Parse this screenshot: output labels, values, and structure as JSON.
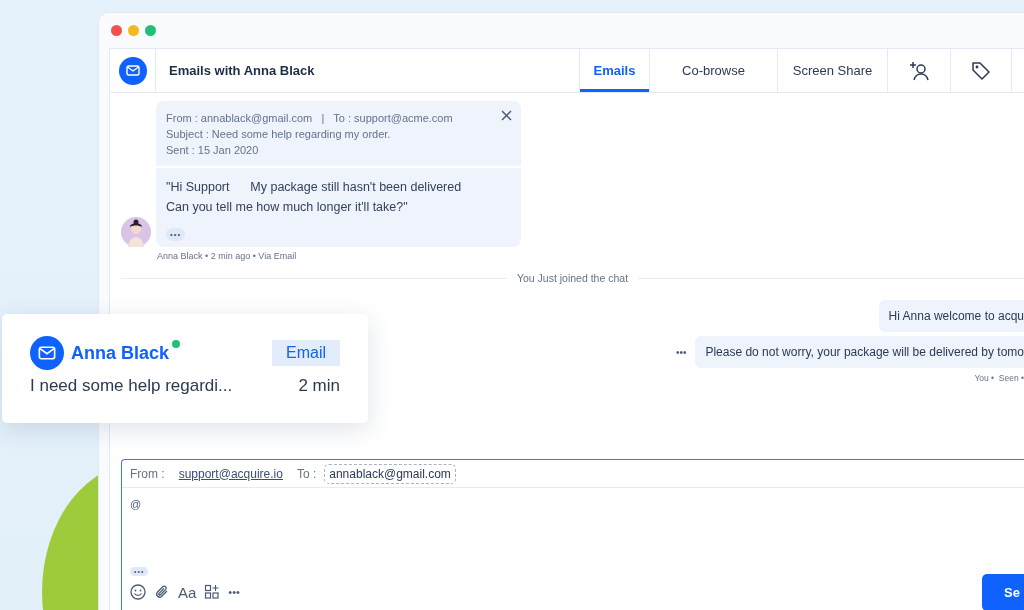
{
  "window": {
    "title": "Emails with Anna Black"
  },
  "tabs": [
    {
      "label": "Emails",
      "selected": true
    },
    {
      "label": "Co-browse",
      "selected": false
    },
    {
      "label": "Screen Share",
      "selected": false
    }
  ],
  "email": {
    "header": "From : annablack@gmail.com   |   To : support@acme.com",
    "subject": "Subject : Need some help regarding my order.",
    "sent": "Sent : 15 Jan 2020",
    "body_lines": [
      "\"Hi Support      My package still hasn't been delivered",
      "Can you tell me how much longer it'll take?\""
    ],
    "more": "•••",
    "meta": "Anna Black • 2 min ago • Via Email"
  },
  "divider": "You Just joined the chat",
  "messages": [
    {
      "text": "Hi Anna welcome to acqu"
    },
    {
      "text": "Please do not worry, your package will be delivered by tomo",
      "menu": "•••"
    }
  ],
  "message_status": "You •  Seen •",
  "composer": {
    "from_label": "From :",
    "from_value": "support@acquire.io",
    "to_label": "To :",
    "to_value": "annablack@gmail.com",
    "body": "@",
    "more": "•••",
    "format_label": "Aa",
    "more_tools": "•••",
    "send": "Se"
  },
  "notification": {
    "name": "Anna Black",
    "online": true,
    "channel": "Email",
    "preview": "I need some help regardi...",
    "time": "2 min"
  }
}
